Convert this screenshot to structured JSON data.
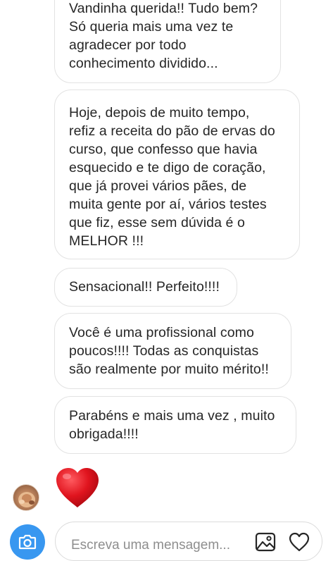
{
  "messages": [
    {
      "text": "Vandinha querida!! Tudo bem?\nSó queria mais uma vez te\nagradecer por todo\nconhecimento dividido..."
    },
    {
      "text": "Hoje, depois de muito tempo,\nrefiz a receita do pão de ervas do\ncurso, que confesso que havia\nesquecido e te digo de coração,\nque já provei vários pães, de\nmuita gente por aí, vários testes\nque fiz, esse sem dúvida é o\nMELHOR !!!"
    },
    {
      "text": "Sensacional!! Perfeito!!!!"
    },
    {
      "text": "Você é uma profissional como\npoucos!!!! Todas as conquistas\nsão realmente por muito mérito!!"
    },
    {
      "text": "Parabéns e mais uma vez , muito\nobrigada!!!!"
    }
  ],
  "reaction": {
    "icon": "red-heart-icon",
    "color": "#e0141e"
  },
  "composer": {
    "placeholder": "Escreva uma mensagem...",
    "camera_icon": "camera-icon",
    "gallery_icon": "image-gallery-icon",
    "like_icon": "heart-outline-icon",
    "accent_color": "#3897f0"
  }
}
